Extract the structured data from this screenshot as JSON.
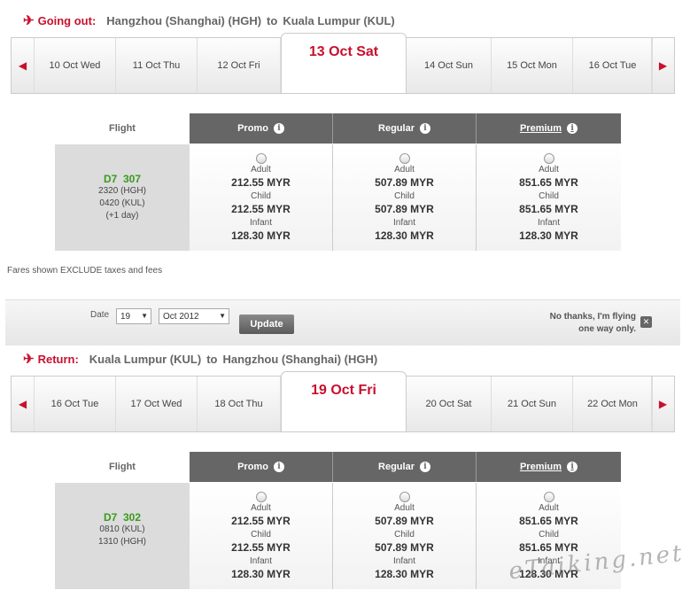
{
  "outbound": {
    "label": "Going out:",
    "from": "Hangzhou (Shanghai) (HGH)",
    "to_word": "to",
    "to": "Kuala Lumpur (KUL)",
    "dates": [
      "10 Oct Wed",
      "11 Oct Thu",
      "12 Oct Fri",
      "13 Oct Sat",
      "14 Oct Sun",
      "15 Oct Mon",
      "16 Oct Tue"
    ],
    "flight_header": "Flight",
    "fare_headers": [
      "Promo",
      "Regular",
      "Premium"
    ],
    "flight": {
      "code": "D7",
      "number": "307",
      "dep": "2320  (HGH)",
      "arr": "0420  (KUL)",
      "extra": "(+1 day)"
    },
    "fares": [
      {
        "adult": "212.55 MYR",
        "child": "212.55 MYR",
        "infant": "128.30 MYR"
      },
      {
        "adult": "507.89 MYR",
        "child": "507.89 MYR",
        "infant": "128.30 MYR"
      },
      {
        "adult": "851.65 MYR",
        "child": "851.65 MYR",
        "infant": "128.30 MYR"
      }
    ]
  },
  "labels": {
    "adult": "Adult",
    "child": "Child",
    "infant": "Infant"
  },
  "note": "Fares shown EXCLUDE taxes and fees",
  "date_bar": {
    "date_label": "Date",
    "day_value": "19",
    "month_value": "Oct 2012",
    "update": "Update",
    "one_way_line1": "No thanks, I'm flying",
    "one_way_line2": "one way only."
  },
  "return": {
    "label": "Return:",
    "from": "Kuala Lumpur (KUL)",
    "to_word": "to",
    "to": "Hangzhou (Shanghai) (HGH)",
    "dates": [
      "16 Oct Tue",
      "17 Oct Wed",
      "18 Oct Thu",
      "19 Oct Fri",
      "20 Oct Sat",
      "21 Oct Sun",
      "22 Oct Mon"
    ],
    "flight_header": "Flight",
    "fare_headers": [
      "Promo",
      "Regular",
      "Premium"
    ],
    "flight": {
      "code": "D7",
      "number": "302",
      "dep": "0810  (KUL)",
      "arr": "1310  (HGH)"
    },
    "fares": [
      {
        "adult": "212.55 MYR",
        "child": "212.55 MYR",
        "infant": "128.30 MYR"
      },
      {
        "adult": "507.89 MYR",
        "child": "507.89 MYR",
        "infant": "128.30 MYR"
      },
      {
        "adult": "851.65 MYR",
        "child": "851.65 MYR",
        "infant": "128.30 MYR"
      }
    ]
  },
  "watermark": "eTaiking.net",
  "colors": {
    "accent": "#c8102e",
    "flight_green": "#3a9a1e",
    "header_gray": "#666666"
  }
}
